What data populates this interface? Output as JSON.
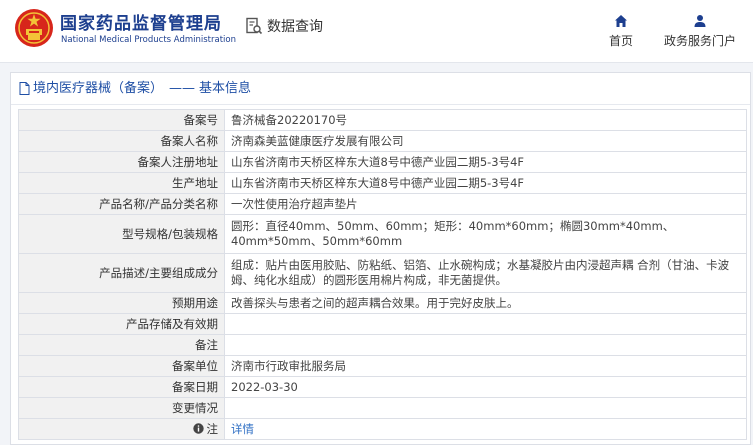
{
  "header": {
    "title_cn": "国家药品监督管理局",
    "title_en": "National Medical Products Administration",
    "data_query": "数据查询",
    "nav": [
      {
        "label": "首页",
        "icon": "home-icon"
      },
      {
        "label": "政务服务门户",
        "icon": "user-icon"
      }
    ]
  },
  "breadcrumb": {
    "link": "境内医疗器械（备案）",
    "separator": "——",
    "current": "基本信息"
  },
  "table": {
    "rows": [
      {
        "label": "备案号",
        "value": "鲁济械备20220170号"
      },
      {
        "label": "备案人名称",
        "value": "济南森美蓝健康医疗发展有限公司"
      },
      {
        "label": "备案人注册地址",
        "value": "山东省济南市天桥区梓东大道8号中德产业园二期5-3号4F"
      },
      {
        "label": "生产地址",
        "value": "山东省济南市天桥区梓东大道8号中德产业园二期5-3号4F"
      },
      {
        "label": "产品名称/产品分类名称",
        "value": "一次性使用治疗超声垫片"
      },
      {
        "label": "型号规格/包装规格",
        "value": "圆形：直径40mm、50mm、60mm；矩形：40mm*60mm；椭圆30mm*40mm、40mm*50mm、50mm*60mm"
      },
      {
        "label": "产品描述/主要组成成分",
        "value": "组成：贴片由医用胶贴、防粘纸、铝箔、止水碗构成；水基凝胶片由内浸超声耦 合剂（甘油、卡波姆、纯化水组成）的圆形医用棉片构成，非无菌提供。"
      },
      {
        "label": "预期用途",
        "value": "改善探头与患者之间的超声耦合效果。用于完好皮肤上。"
      },
      {
        "label": "产品存储及有效期",
        "value": ""
      },
      {
        "label": "备注",
        "value": ""
      },
      {
        "label": "备案单位",
        "value": "济南市行政审批服务局"
      },
      {
        "label": "备案日期",
        "value": "2022-03-30"
      },
      {
        "label": "变更情况",
        "value": ""
      }
    ],
    "note_row": {
      "label": "注",
      "link": "详情"
    }
  },
  "colors": {
    "brand_blue": "#1d3f8f",
    "link_blue": "#2f6fc4",
    "emblem_red": "#d7261b",
    "emblem_gold": "#f3c237"
  }
}
